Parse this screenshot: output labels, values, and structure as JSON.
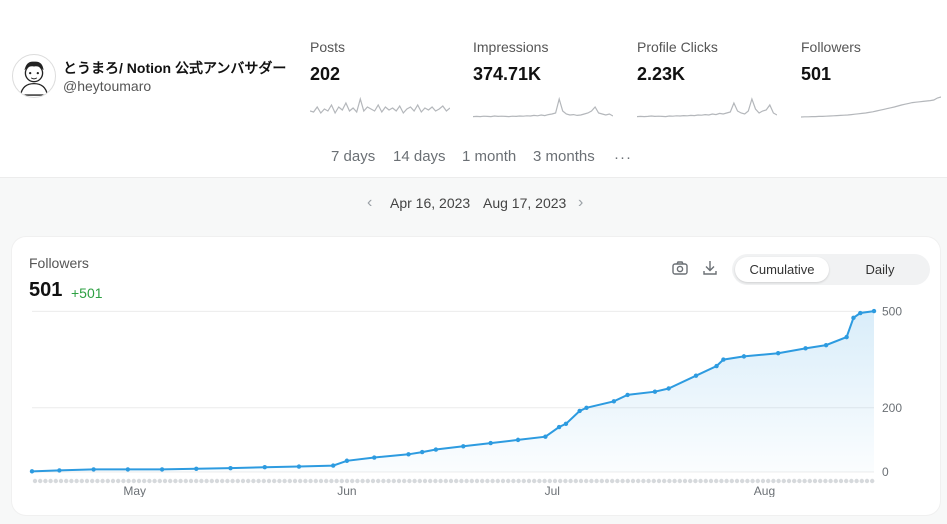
{
  "profile": {
    "name": "とうまろ/ Notion 公式アンバサダー",
    "handle": "@heytoumaro",
    "avatar_icon": "avatar-illustration-icon"
  },
  "stats": [
    {
      "label": "Posts",
      "value": "202",
      "spark": [
        0.3,
        0.25,
        0.5,
        0.2,
        0.4,
        0.3,
        0.6,
        0.2,
        0.5,
        0.35,
        0.7,
        0.3,
        0.45,
        0.25,
        0.9,
        0.3,
        0.5,
        0.4,
        0.3,
        0.6,
        0.25,
        0.5,
        0.35,
        0.45,
        0.3,
        0.55,
        0.2,
        0.4,
        0.5,
        0.3,
        0.6,
        0.25,
        0.45,
        0.35,
        0.5,
        0.3,
        0.4,
        0.55,
        0.3,
        0.45
      ]
    },
    {
      "label": "Impressions",
      "value": "374.71K",
      "spark": [
        0.02,
        0.03,
        0.02,
        0.04,
        0.03,
        0.02,
        0.05,
        0.03,
        0.04,
        0.03,
        0.02,
        0.04,
        0.03,
        0.05,
        0.04,
        0.06,
        0.05,
        0.08,
        0.06,
        0.1,
        0.07,
        0.12,
        0.15,
        0.2,
        0.9,
        0.3,
        0.15,
        0.1,
        0.12,
        0.08,
        0.1,
        0.15,
        0.2,
        0.3,
        0.5,
        0.2,
        0.15,
        0.1,
        0.15,
        0.05
      ]
    },
    {
      "label": "Profile Clicks",
      "value": "2.23K",
      "spark": [
        0.02,
        0.03,
        0.02,
        0.03,
        0.05,
        0.03,
        0.04,
        0.03,
        0.02,
        0.05,
        0.04,
        0.06,
        0.05,
        0.07,
        0.06,
        0.08,
        0.07,
        0.1,
        0.09,
        0.12,
        0.1,
        0.15,
        0.12,
        0.18,
        0.15,
        0.2,
        0.25,
        0.7,
        0.3,
        0.2,
        0.15,
        0.3,
        0.9,
        0.4,
        0.2,
        0.3,
        0.35,
        0.6,
        0.2,
        0.1
      ]
    },
    {
      "label": "Followers",
      "value": "501",
      "spark": [
        0.0,
        0.01,
        0.01,
        0.02,
        0.02,
        0.03,
        0.03,
        0.04,
        0.05,
        0.06,
        0.07,
        0.08,
        0.09,
        0.1,
        0.12,
        0.14,
        0.16,
        0.18,
        0.2,
        0.23,
        0.26,
        0.3,
        0.34,
        0.38,
        0.42,
        0.46,
        0.5,
        0.55,
        0.6,
        0.64,
        0.68,
        0.72,
        0.74,
        0.76,
        0.78,
        0.8,
        0.82,
        0.85,
        0.95,
        1.0
      ]
    }
  ],
  "ranges": {
    "opt1": "7 days",
    "opt2": "14 days",
    "opt3": "1 month",
    "opt4": "3 months",
    "more": "···"
  },
  "dates": {
    "start": "Apr 16, 2023",
    "end": "Aug 17, 2023"
  },
  "card": {
    "title": "Followers",
    "value": "501",
    "delta": "+501",
    "toggle_cumulative": "Cumulative",
    "toggle_daily": "Daily",
    "active_toggle": "Cumulative",
    "icons": [
      "camera-icon",
      "download-icon"
    ]
  },
  "colors": {
    "accent": "#2d9be0",
    "positive": "#2ea043",
    "spark": "#b4b7bb"
  },
  "chart_data": {
    "type": "area",
    "title": "Followers",
    "ylim": [
      0,
      520
    ],
    "y_ticks": [
      0,
      200,
      500
    ],
    "x_tick_labels": [
      "May",
      "Jun",
      "Jul",
      "Aug"
    ],
    "x_start": "2023-04-16",
    "x_end": "2023-08-17",
    "grid": true,
    "series": [
      {
        "x": [
          "2023-04-16",
          "2023-04-20",
          "2023-04-25",
          "2023-04-30",
          "2023-05-05",
          "2023-05-10",
          "2023-05-15",
          "2023-05-20",
          "2023-05-25",
          "2023-05-30",
          "2023-06-01",
          "2023-06-05",
          "2023-06-10",
          "2023-06-12",
          "2023-06-14",
          "2023-06-18",
          "2023-06-22",
          "2023-06-26",
          "2023-06-30",
          "2023-07-02",
          "2023-07-03",
          "2023-07-05",
          "2023-07-06",
          "2023-07-10",
          "2023-07-12",
          "2023-07-16",
          "2023-07-18",
          "2023-07-22",
          "2023-07-25",
          "2023-07-26",
          "2023-07-29",
          "2023-08-03",
          "2023-08-07",
          "2023-08-10",
          "2023-08-13",
          "2023-08-14",
          "2023-08-15",
          "2023-08-17"
        ],
        "values": [
          2,
          5,
          8,
          8,
          8,
          10,
          12,
          15,
          17,
          20,
          35,
          45,
          55,
          62,
          70,
          80,
          90,
          100,
          110,
          140,
          150,
          190,
          200,
          220,
          240,
          250,
          260,
          300,
          330,
          350,
          360,
          370,
          385,
          395,
          420,
          480,
          495,
          501
        ]
      }
    ]
  }
}
